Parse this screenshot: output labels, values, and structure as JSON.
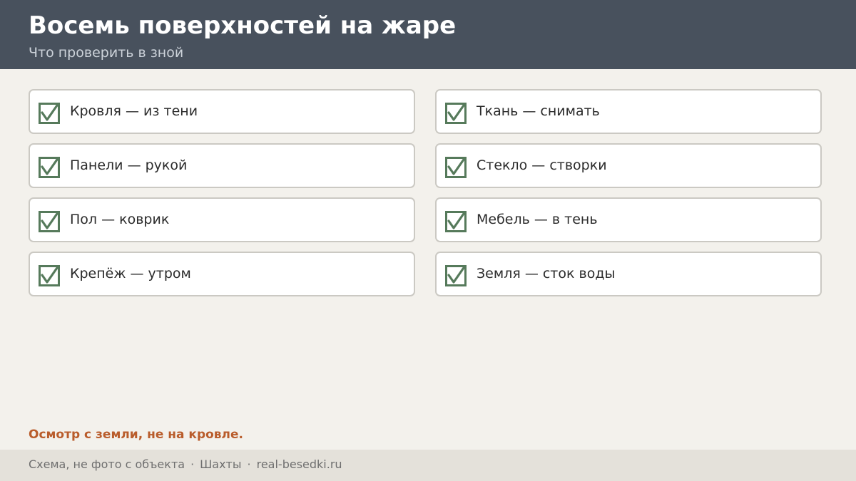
{
  "header": {
    "title": "Восемь поверхностей на жаре",
    "subtitle": "Что проверить в зной"
  },
  "checklist": {
    "left": [
      {
        "label": "Кровля — из тени",
        "checked": true
      },
      {
        "label": "Панели — рукой",
        "checked": true
      },
      {
        "label": "Пол — коврик",
        "checked": true
      },
      {
        "label": "Крепёж — утром",
        "checked": true
      }
    ],
    "right": [
      {
        "label": "Ткань — снимать",
        "checked": true
      },
      {
        "label": "Стекло — створки",
        "checked": true
      },
      {
        "label": "Мебель — в тень",
        "checked": true
      },
      {
        "label": "Земля — сток воды",
        "checked": true
      }
    ]
  },
  "note": "Осмотр с земли, не на кровле.",
  "footer": {
    "caption": "Схема, не фото с объекта",
    "separator": "·",
    "location": "Шахты",
    "site": "real-besedki.ru"
  },
  "colors": {
    "header_bg": "#48515d",
    "page_bg": "#f3f1ec",
    "check_green": "#567a5b",
    "note_accent": "#b95c2b",
    "footer_bg": "#e4e1da"
  },
  "icons": {
    "check": "checkbox-checked-icon"
  }
}
